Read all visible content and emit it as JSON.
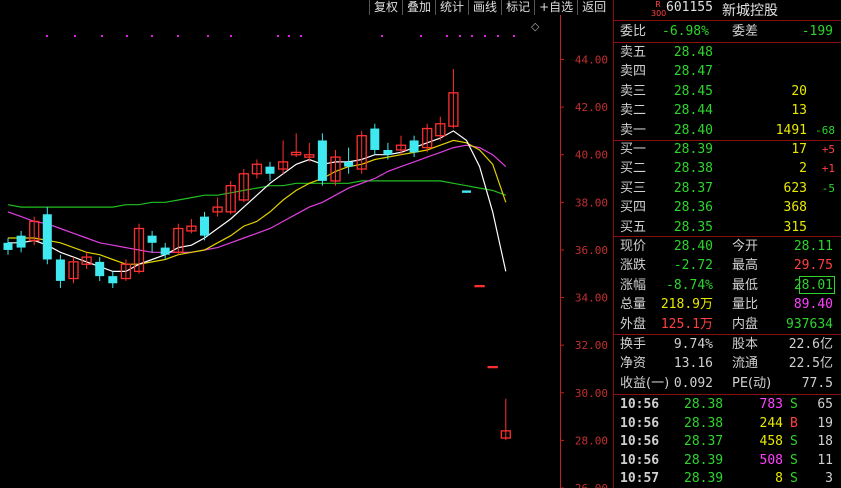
{
  "toolbar": [
    "复权",
    "叠加",
    "统计",
    "画线",
    "标记",
    "+自选",
    "返回"
  ],
  "stock": {
    "code": "601155",
    "name": "新城控股",
    "badge_top": "R",
    "badge_bottom": "300"
  },
  "colors": {
    "up": "#ff3030",
    "down": "#40e8f0",
    "ma5": "#ffffff",
    "ma10": "#e0d000",
    "ma20": "#e040e0",
    "ma60": "#20c020",
    "axis": "#c02020",
    "grid": "#8a1010",
    "marker": "#e020e0"
  },
  "header": {
    "wb_label": "委比",
    "wb_value": "-6.98%",
    "wc_label": "委差",
    "wc_value": "-199"
  },
  "asks": [
    {
      "label": "卖五",
      "price": "28.48",
      "vol": "",
      "chg": ""
    },
    {
      "label": "卖四",
      "price": "28.47",
      "vol": "",
      "chg": ""
    },
    {
      "label": "卖三",
      "price": "28.45",
      "vol": "20",
      "chg": ""
    },
    {
      "label": "卖二",
      "price": "28.44",
      "vol": "13",
      "chg": ""
    },
    {
      "label": "卖一",
      "price": "28.40",
      "vol": "1491",
      "chg": "-68"
    }
  ],
  "bids": [
    {
      "label": "买一",
      "price": "28.39",
      "vol": "17",
      "chg": "+5"
    },
    {
      "label": "买二",
      "price": "28.38",
      "vol": "2",
      "chg": "+1"
    },
    {
      "label": "买三",
      "price": "28.37",
      "vol": "623",
      "chg": "-5"
    },
    {
      "label": "买四",
      "price": "28.36",
      "vol": "368",
      "chg": ""
    },
    {
      "label": "买五",
      "price": "28.35",
      "vol": "315",
      "chg": ""
    }
  ],
  "quote": [
    {
      "l1": "现价",
      "v1": "28.40",
      "l2": "今开",
      "v2": "28.11"
    },
    {
      "l1": "涨跌",
      "v1": "-2.72",
      "l2": "最高",
      "v2": "29.75"
    },
    {
      "l1": "涨幅",
      "v1": "-8.74%",
      "l2": "最低",
      "v2": "28.01"
    },
    {
      "l1": "总量",
      "v1": "218.9万",
      "l2": "量比",
      "v2": "89.40"
    },
    {
      "l1": "外盘",
      "v1": "125.1万",
      "l2": "内盘",
      "v2": "937634"
    }
  ],
  "stats": [
    {
      "l1": "换手",
      "v1": "9.74%",
      "l2": "股本",
      "v2": "22.6亿"
    },
    {
      "l1": "净资",
      "v1": "13.16",
      "l2": "流通",
      "v2": "22.5亿"
    },
    {
      "l1": "收益(一)",
      "v1": "0.092",
      "l2": "PE(动)",
      "v2": "77.5"
    }
  ],
  "ticks": [
    {
      "time": "10:56",
      "price": "28.38",
      "vol": "783",
      "side": "S",
      "num": "65"
    },
    {
      "time": "10:56",
      "price": "28.38",
      "vol": "244",
      "side": "B",
      "num": "19"
    },
    {
      "time": "10:56",
      "price": "28.37",
      "vol": "458",
      "side": "S",
      "num": "18"
    },
    {
      "time": "10:56",
      "price": "28.39",
      "vol": "508",
      "side": "S",
      "num": "11"
    },
    {
      "time": "10:57",
      "price": "28.39",
      "vol": "8",
      "side": "S",
      "num": "3"
    }
  ],
  "chart_data": {
    "type": "candlestick",
    "ylim": [
      26.0,
      46.5
    ],
    "yticks": [
      {
        "label": "44.00",
        "value": 44
      },
      {
        "label": "42.00",
        "value": 42
      },
      {
        "label": "40.00",
        "value": 40
      },
      {
        "label": "38.00",
        "value": 38
      },
      {
        "label": "36.00",
        "value": 36
      },
      {
        "label": "34.00",
        "value": 34
      },
      {
        "label": "32.00",
        "value": 32
      },
      {
        "label": "30.00",
        "value": 30
      },
      {
        "label": "28.00",
        "value": 28
      },
      {
        "label": "26.00",
        "value": 26
      }
    ],
    "candles": [
      {
        "o": 36.3,
        "c": 36.0,
        "h": 36.5,
        "l": 35.8
      },
      {
        "o": 36.6,
        "c": 36.1,
        "h": 36.8,
        "l": 35.9
      },
      {
        "o": 36.4,
        "c": 37.2,
        "h": 37.4,
        "l": 36.2
      },
      {
        "o": 37.5,
        "c": 35.6,
        "h": 37.8,
        "l": 35.4
      },
      {
        "o": 35.6,
        "c": 34.7,
        "h": 35.8,
        "l": 34.4
      },
      {
        "o": 34.8,
        "c": 35.5,
        "h": 35.7,
        "l": 34.6
      },
      {
        "o": 35.4,
        "c": 35.7,
        "h": 35.9,
        "l": 35.2
      },
      {
        "o": 35.5,
        "c": 34.9,
        "h": 35.7,
        "l": 34.7
      },
      {
        "o": 34.9,
        "c": 34.6,
        "h": 35.1,
        "l": 34.4
      },
      {
        "o": 34.8,
        "c": 35.4,
        "h": 35.6,
        "l": 34.7
      },
      {
        "o": 35.1,
        "c": 36.9,
        "h": 37.1,
        "l": 35.0
      },
      {
        "o": 36.6,
        "c": 36.3,
        "h": 36.8,
        "l": 35.9
      },
      {
        "o": 36.1,
        "c": 35.8,
        "h": 36.3,
        "l": 35.6
      },
      {
        "o": 35.9,
        "c": 36.9,
        "h": 37.1,
        "l": 35.8
      },
      {
        "o": 36.8,
        "c": 37.0,
        "h": 37.3,
        "l": 36.7
      },
      {
        "o": 37.4,
        "c": 36.6,
        "h": 37.6,
        "l": 36.4
      },
      {
        "o": 37.6,
        "c": 37.8,
        "h": 38.2,
        "l": 37.4
      },
      {
        "o": 37.6,
        "c": 38.7,
        "h": 38.9,
        "l": 37.5
      },
      {
        "o": 38.1,
        "c": 39.2,
        "h": 39.4,
        "l": 38.0
      },
      {
        "o": 39.2,
        "c": 39.6,
        "h": 39.8,
        "l": 39.0
      },
      {
        "o": 39.5,
        "c": 39.2,
        "h": 39.7,
        "l": 38.9
      },
      {
        "o": 39.4,
        "c": 39.7,
        "h": 40.6,
        "l": 39.2
      },
      {
        "o": 40.0,
        "c": 40.1,
        "h": 40.9,
        "l": 39.9
      },
      {
        "o": 39.9,
        "c": 40.0,
        "h": 40.5,
        "l": 39.7
      },
      {
        "o": 40.6,
        "c": 38.9,
        "h": 40.9,
        "l": 38.7
      },
      {
        "o": 38.9,
        "c": 39.9,
        "h": 40.2,
        "l": 38.7
      },
      {
        "o": 39.7,
        "c": 39.5,
        "h": 40.3,
        "l": 39.2
      },
      {
        "o": 39.4,
        "c": 40.8,
        "h": 41.0,
        "l": 39.2
      },
      {
        "o": 41.1,
        "c": 40.2,
        "h": 41.3,
        "l": 40.0
      },
      {
        "o": 40.2,
        "c": 40.0,
        "h": 40.5,
        "l": 39.8
      },
      {
        "o": 40.2,
        "c": 40.4,
        "h": 40.8,
        "l": 40.0
      },
      {
        "o": 40.6,
        "c": 40.1,
        "h": 40.8,
        "l": 39.9
      },
      {
        "o": 40.3,
        "c": 41.1,
        "h": 41.3,
        "l": 40.1
      },
      {
        "o": 40.8,
        "c": 41.3,
        "h": 41.6,
        "l": 40.6
      },
      {
        "o": 41.2,
        "c": 42.6,
        "h": 43.6,
        "l": 41.1
      },
      {
        "o": 38.5,
        "c": 38.4,
        "h": 38.5,
        "l": 38.4
      },
      {
        "o": 34.5,
        "c": 34.5,
        "h": 34.5,
        "l": 34.5
      },
      {
        "o": 31.1,
        "c": 31.1,
        "h": 31.1,
        "l": 31.1
      },
      {
        "o": 28.1,
        "c": 28.4,
        "h": 29.75,
        "l": 28.01
      }
    ],
    "ma5": [
      36.3,
      36.3,
      36.4,
      36.2,
      35.9,
      35.7,
      35.5,
      35.3,
      35.1,
      35.1,
      35.4,
      35.6,
      35.8,
      36.1,
      36.2,
      36.5,
      36.9,
      37.3,
      37.8,
      38.3,
      38.8,
      39.2,
      39.6,
      39.8,
      39.6,
      39.7,
      39.7,
      39.8,
      40.0,
      40.0,
      40.1,
      40.3,
      40.5,
      40.7,
      41.0,
      40.6,
      39.5,
      37.6,
      35.1
    ],
    "ma10": [
      36.5,
      36.5,
      36.5,
      36.4,
      36.3,
      36.1,
      35.9,
      35.8,
      35.6,
      35.4,
      35.4,
      35.5,
      35.6,
      35.8,
      35.9,
      36.0,
      36.3,
      36.6,
      37.0,
      37.2,
      37.6,
      38.1,
      38.5,
      38.8,
      39.0,
      39.3,
      39.5,
      39.6,
      39.8,
      39.9,
      40.0,
      40.1,
      40.2,
      40.4,
      40.6,
      40.5,
      40.2,
      39.6,
      38.0
    ],
    "ma20": [
      37.6,
      37.4,
      37.2,
      37.1,
      36.9,
      36.7,
      36.5,
      36.3,
      36.2,
      36.1,
      36.0,
      35.9,
      35.9,
      35.9,
      35.9,
      36.0,
      36.1,
      36.3,
      36.5,
      36.7,
      36.9,
      37.2,
      37.5,
      37.8,
      38.0,
      38.3,
      38.6,
      38.8,
      39.0,
      39.3,
      39.5,
      39.7,
      39.9,
      40.1,
      40.3,
      40.4,
      40.3,
      40.0,
      39.5
    ],
    "ma60": [
      37.9,
      37.8,
      37.8,
      37.8,
      37.8,
      37.8,
      37.8,
      37.8,
      37.8,
      37.9,
      37.9,
      38.0,
      38.0,
      38.1,
      38.2,
      38.3,
      38.3,
      38.4,
      38.5,
      38.6,
      38.7,
      38.7,
      38.8,
      38.8,
      38.8,
      38.8,
      38.8,
      38.9,
      38.9,
      38.9,
      38.9,
      38.9,
      38.9,
      38.9,
      38.8,
      38.7,
      38.6,
      38.5,
      38.3
    ]
  }
}
